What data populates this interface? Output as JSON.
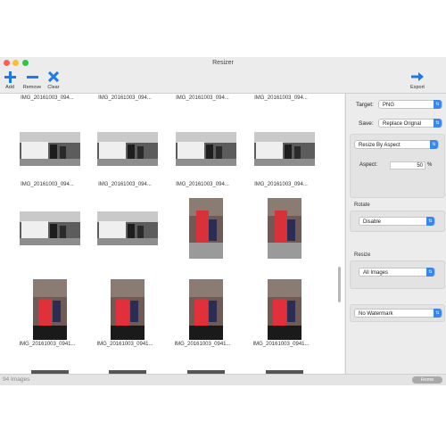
{
  "window": {
    "title": "Resizer"
  },
  "toolbar": {
    "add_label": "Add",
    "remove_label": "Remove",
    "clear_label": "Clear",
    "export_label": "Export",
    "accent": "#1e7be6"
  },
  "grid": {
    "top_row_names": [
      "IMG_20161003_094...",
      "IMG_20161003_094...",
      "IMG_20161003_094...",
      "IMG_20161003_094..."
    ],
    "row1_names": [
      "IMG_20161003_094...",
      "IMG_20161003_094...",
      "IMG_20161003_094...",
      "IMG_20161003_094..."
    ],
    "row3_names": [
      "IMG_20161003_0941...",
      "IMG_20161003_0941...",
      "IMG_20161003_0941...",
      "IMG_20161003_0941..."
    ]
  },
  "sidebar": {
    "target_label": "Target:",
    "target_value": "PNG",
    "save_label": "Save:",
    "save_value": "Replace Orignal",
    "resize_mode": "Resize By Aspect",
    "aspect_label": "Aspect:",
    "aspect_value": "50",
    "aspect_unit": "%",
    "rotate_title": "Rotate",
    "rotate_value": "Disable",
    "resize_title": "Resize",
    "resize_value": "All Images",
    "watermark_value": "No Watermark"
  },
  "status": {
    "count_text": "94 Images",
    "home_label": "Home"
  }
}
